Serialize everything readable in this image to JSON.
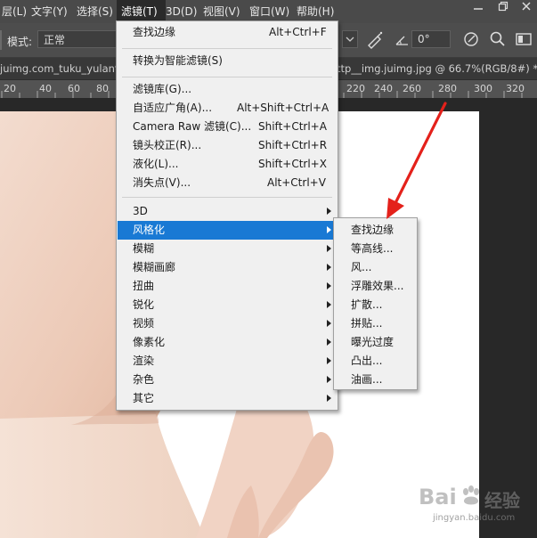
{
  "menubar": {
    "items": [
      "层(L)",
      "文字(Y)",
      "选择(S)",
      "滤镜(T)",
      "3D(D)",
      "视图(V)",
      "窗口(W)",
      "帮助(H)"
    ],
    "active_index": 3,
    "controls": [
      "minimize-icon",
      "restore-icon",
      "close-icon"
    ]
  },
  "options": {
    "mode_label": "模式:",
    "mode_value": "正常",
    "angle_value": "0°"
  },
  "tab": {
    "left_text": "juimg.com_tuku_yulantu_",
    "right_text": "ttp__img.juimg.jpg @ 66.7%(RGB/8#) *"
  },
  "ruler": {
    "ticks": [
      "20",
      "40",
      "60",
      "80",
      "220",
      "240",
      "260",
      "280",
      "300",
      "320"
    ]
  },
  "filter_menu": {
    "items": [
      {
        "label": "查找边缘",
        "shortcut": "Alt+Ctrl+F"
      },
      {
        "label": "转换为智能滤镜(S)",
        "shortcut": ""
      },
      {
        "label": "滤镜库(G)...",
        "shortcut": ""
      },
      {
        "label": "自适应广角(A)...",
        "shortcut": "Alt+Shift+Ctrl+A"
      },
      {
        "label": "Camera Raw 滤镜(C)...",
        "shortcut": "Shift+Ctrl+A"
      },
      {
        "label": "镜头校正(R)...",
        "shortcut": "Shift+Ctrl+R"
      },
      {
        "label": "液化(L)...",
        "shortcut": "Shift+Ctrl+X"
      },
      {
        "label": "消失点(V)...",
        "shortcut": "Alt+Ctrl+V"
      },
      {
        "label": "3D",
        "shortcut": ""
      },
      {
        "label": "风格化",
        "shortcut": ""
      },
      {
        "label": "模糊",
        "shortcut": ""
      },
      {
        "label": "模糊画廊",
        "shortcut": ""
      },
      {
        "label": "扭曲",
        "shortcut": ""
      },
      {
        "label": "锐化",
        "shortcut": ""
      },
      {
        "label": "视频",
        "shortcut": ""
      },
      {
        "label": "像素化",
        "shortcut": ""
      },
      {
        "label": "渲染",
        "shortcut": ""
      },
      {
        "label": "杂色",
        "shortcut": ""
      },
      {
        "label": "其它",
        "shortcut": ""
      }
    ],
    "highlighted_index": 9
  },
  "stylize_submenu": {
    "items": [
      "查找边缘",
      "等高线...",
      "风...",
      "浮雕效果...",
      "扩散...",
      "拼贴...",
      "曝光过度",
      "凸出...",
      "油画..."
    ]
  },
  "watermark": {
    "brand": "Bai",
    "brand_suffix": "经验",
    "url": "jingyan.baidu.com"
  },
  "colors": {
    "highlight": "#1979d4",
    "arrow": "#e4211b",
    "menu_bg": "#f0f0f0"
  }
}
